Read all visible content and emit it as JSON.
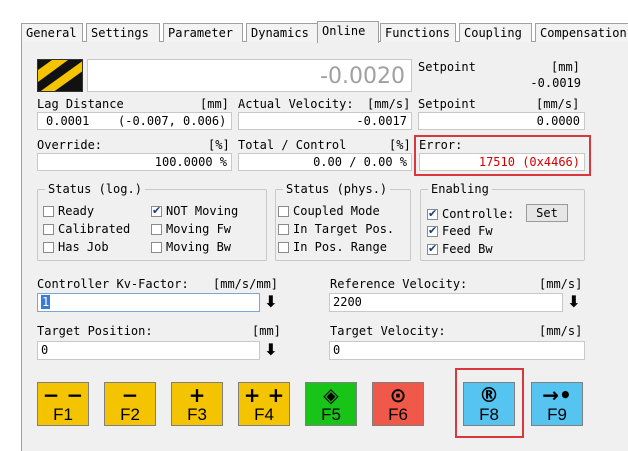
{
  "tabs": [
    {
      "label": "General",
      "active": false
    },
    {
      "label": "Settings",
      "active": false
    },
    {
      "label": "Parameter",
      "active": false
    },
    {
      "label": "Dynamics",
      "active": false
    },
    {
      "label": "Online",
      "active": true
    },
    {
      "label": "Functions",
      "active": false
    },
    {
      "label": "Coupling",
      "active": false
    },
    {
      "label": "Compensation",
      "active": false
    }
  ],
  "position_display": {
    "value": "-0.0020"
  },
  "setpoint_pos": {
    "label": "Setpoint",
    "unit": "[mm]",
    "value": "-0.0019"
  },
  "lag_distance": {
    "label": "Lag Distance",
    "unit": "[mm]",
    "value": "0.0001",
    "range": "(-0.007, 0.006)"
  },
  "actual_velocity": {
    "label": "Actual Velocity:",
    "unit": "[mm/s]",
    "value": "-0.0017"
  },
  "setpoint_vel": {
    "label": "Setpoint",
    "unit": "[mm/s]",
    "value": "0.0000"
  },
  "override": {
    "label": "Override:",
    "unit": "[%]",
    "value": "100.0000 %"
  },
  "total_control": {
    "label": "Total / Control",
    "unit": "[%]",
    "value": "0.00 /  0.00 %"
  },
  "error": {
    "label": "Error:",
    "value": "17510  (0x4466)",
    "color": "#d40000"
  },
  "status_log": {
    "title": "Status (log.)",
    "items": [
      {
        "label": "Ready",
        "checked": false
      },
      {
        "label": "NOT Moving",
        "checked": true
      },
      {
        "label": "Calibrated",
        "checked": false
      },
      {
        "label": "Moving Fw",
        "checked": false
      },
      {
        "label": "Has Job",
        "checked": false
      },
      {
        "label": "Moving Bw",
        "checked": false
      }
    ]
  },
  "status_phys": {
    "title": "Status (phys.)",
    "items": [
      {
        "label": "Coupled Mode",
        "checked": false
      },
      {
        "label": "In Target Pos.",
        "checked": false
      },
      {
        "label": "In Pos. Range",
        "checked": false
      }
    ]
  },
  "enabling": {
    "title": "Enabling",
    "items": [
      {
        "label": "Controlle:",
        "checked": true
      },
      {
        "label": "Feed Fw",
        "checked": true
      },
      {
        "label": "Feed Bw",
        "checked": true
      }
    ],
    "set_label": "Set"
  },
  "kv_factor": {
    "label": "Controller Kv-Factor:",
    "unit": "[mm/s/mm]",
    "value": "1"
  },
  "reference_velocity": {
    "label": "Reference Velocity:",
    "unit": "[mm/s]",
    "value": "2200"
  },
  "target_position": {
    "label": "Target Position:",
    "unit": "[mm]",
    "value": "0"
  },
  "target_velocity": {
    "label": "Target Velocity:",
    "unit": "[mm/s]",
    "value": "0"
  },
  "function_keys": [
    {
      "label": "F1",
      "icon": "− −",
      "color": "#f5c400"
    },
    {
      "label": "F2",
      "icon": "−",
      "color": "#f5c400"
    },
    {
      "label": "F3",
      "icon": "+",
      "color": "#f5c400"
    },
    {
      "label": "F4",
      "icon": "+ +",
      "color": "#f5c400"
    },
    {
      "label": "F5",
      "icon": "◈",
      "color": "#18c418"
    },
    {
      "label": "F6",
      "icon": "⊙",
      "color": "#f0584a"
    },
    {
      "label": "F8",
      "icon": "®",
      "color": "#56c4f0"
    },
    {
      "label": "F9",
      "icon": "→•",
      "color": "#56c4f0"
    }
  ]
}
